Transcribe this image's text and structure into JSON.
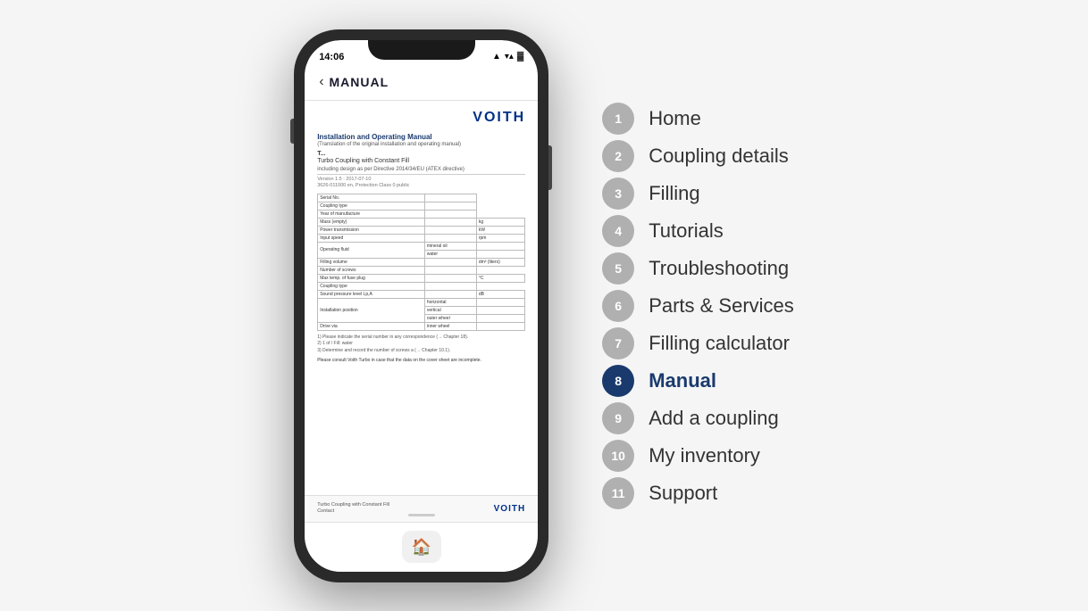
{
  "status_bar": {
    "time": "14:06",
    "signal": "▲",
    "wifi": "WiFi",
    "battery": "Battery"
  },
  "header": {
    "back_label": "‹",
    "title": "MANUAL"
  },
  "manual_page": {
    "logo": "VOITH",
    "title": "Installation and Operating Manual",
    "subtitle": "(Translation of the original installation and operating manual)",
    "model_short": "T...",
    "model_full": "Turbo Coupling with Constant Fill",
    "description": "including design as per Directive 2014/34/EU (ATEX directive)",
    "version1": "Version 1.5 : 2017-07-10",
    "version2": "3626-011000 en, Protection Class 0 public",
    "table_rows": [
      [
        "Serial No.",
        ""
      ],
      [
        "Coupling type",
        ""
      ],
      [
        "Year of manufacture",
        ""
      ],
      [
        "Mass (empty)",
        "",
        "kg"
      ],
      [
        "Power transmission",
        "",
        "kW"
      ],
      [
        "Input speed",
        "",
        "rpm"
      ],
      [
        "Operating fluid",
        "mineral oil",
        ""
      ],
      [
        "",
        "water",
        ""
      ],
      [
        "Filling volume",
        "",
        "dm³ (liters)"
      ],
      [
        "Number of screws",
        ""
      ],
      [
        "Maximum temperature of fuse plug",
        "",
        "°C"
      ],
      [
        "Coupling type",
        ""
      ],
      [
        "Sound pressure level Lp,A",
        "",
        "dB"
      ],
      [
        "Installation position",
        "horizontal",
        ""
      ],
      [
        "",
        "vertical",
        ""
      ],
      [
        "",
        "outer wheel",
        ""
      ],
      [
        "Drive via",
        "inner wheel",
        ""
      ]
    ],
    "notes": [
      "1) Please indicate the serial number in any correspondence (→ Chapter 18).",
      "2) 1 of / Fill: water",
      "3) Determine and record the number of screws a (→ Chapter 10.1)."
    ],
    "consult": "Please consult Voith Turbo in case that the data on the cover sheet are incomplete.",
    "footer_left1": "Turbo Coupling with Constant Fill",
    "footer_left2": "Contact",
    "footer_logo": "VOITH"
  },
  "tab_bar": {
    "home_icon": "🏠"
  },
  "menu": {
    "items": [
      {
        "number": "1",
        "label": "Home",
        "active": false
      },
      {
        "number": "2",
        "label": "Coupling details",
        "active": false
      },
      {
        "number": "3",
        "label": "Filling",
        "active": false
      },
      {
        "number": "4",
        "label": "Tutorials",
        "active": false
      },
      {
        "number": "5",
        "label": "Troubleshooting",
        "active": false
      },
      {
        "number": "6",
        "label": "Parts & Services",
        "active": false
      },
      {
        "number": "7",
        "label": "Filling calculator",
        "active": false
      },
      {
        "number": "8",
        "label": "Manual",
        "active": true
      },
      {
        "number": "9",
        "label": "Add a coupling",
        "active": false
      },
      {
        "number": "10",
        "label": "My inventory",
        "active": false
      },
      {
        "number": "11",
        "label": "Support",
        "active": false
      }
    ]
  }
}
